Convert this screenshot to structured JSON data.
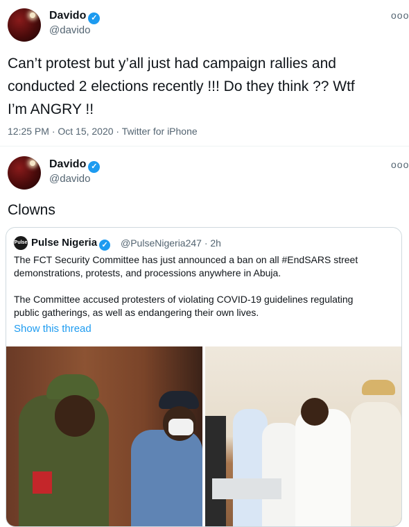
{
  "tweet1": {
    "name": "Davido",
    "handle": "@davido",
    "text_line1": "Can’t protest but y’all just had campaign rallies and",
    "text_line2": "conducted 2 elections recently !!! Do they think ?? Wtf",
    "text_line3": "I’m ANGRY !!",
    "timestamp": "12:25 PM · Oct 15, 2020 · Twitter for iPhone"
  },
  "tweet2": {
    "name": "Davido",
    "handle": "@davido",
    "text": "Clowns"
  },
  "quoted": {
    "name": "Pulse Nigeria",
    "handle_time": "@PulseNigeria247 · 2h",
    "logo_text": "Pulse",
    "para1_line1": "The FCT Security Committee has just announced a ban on all #EndSARS street",
    "para1_line2": "demonstrations, protests, and processions anywhere in Abuja.",
    "para2_line1": "The Committee accused protesters of violating COVID-19 guidelines regulating",
    "para2_line2": "public gatherings, as well as endangering their own lives.",
    "show_thread": "Show this thread"
  },
  "icons": {
    "verified": "verified-badge-icon",
    "more": "more-options-icon"
  },
  "colors": {
    "accent": "#1d9bf0",
    "secondary_text": "#536471"
  }
}
